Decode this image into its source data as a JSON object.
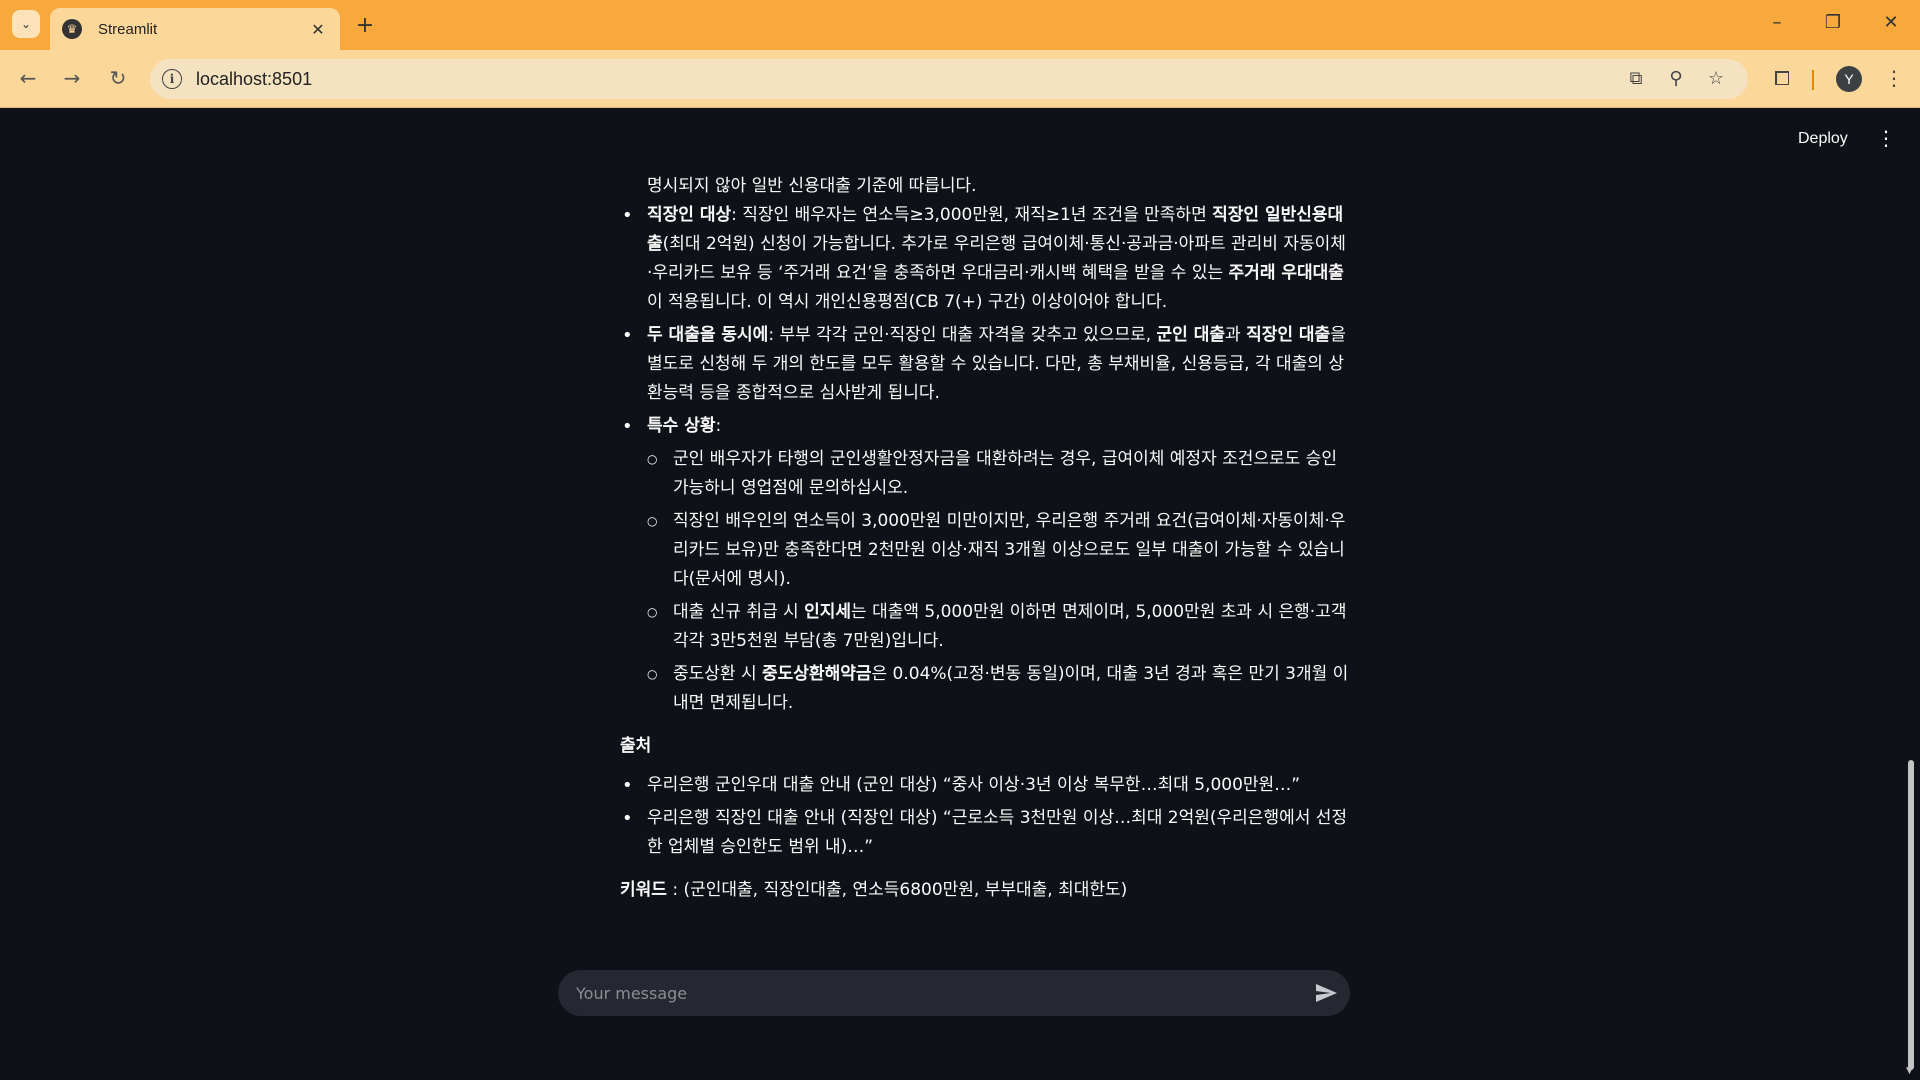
{
  "browser": {
    "tab_title": "Streamlit",
    "url": "localhost:8501",
    "profile_initial": "Y"
  },
  "app": {
    "deploy_label": "Deploy"
  },
  "message": {
    "intro_line": "명시되지 않아 일반 신용대출 기준에 따릅니다.",
    "bullet_worker": {
      "b1": "직장인 대상",
      "t1": ": 직장인 배우자는 연소득≥3,000만원, 재직≥1년 조건을 만족하면 ",
      "b2": "직장인 일반신용대출",
      "t2": "(최대 2억원) 신청이 가능합니다. 추가로 우리은행 급여이체·통신·공과금·아파트 관리비 자동이체·우리카드 보유 등 ‘주거래 요건’을 충족하면 우대금리·캐시백 혜택을 받을 수 있는 ",
      "b3": "주거래 우대대출",
      "t3": "이 적용됩니다. 이 역시 개인신용평점(CB 7(+) 구간) 이상이어야 합니다."
    },
    "bullet_both": {
      "b1": "두 대출을 동시에",
      "t1": ": 부부 각각 군인·직장인 대출 자격을 갖추고 있으므로, ",
      "b2": "군인 대출",
      "t2": "과 ",
      "b3": "직장인 대출",
      "t3": "을 별도로 신청해 두 개의 한도를 모두 활용할 수 있습니다. 다만, 총 부채비율, 신용등급, 각 대출의 상환능력 등을 종합적으로 심사받게 됩니다."
    },
    "bullet_special": {
      "b1": "특수 상황",
      "t1": ":"
    },
    "sub1": "군인 배우자가 타행의 군인생활안정자금을 대환하려는 경우, 급여이체 예정자 조건으로도 승인 가능하니 영업점에 문의하십시오.",
    "sub2": "직장인 배우인의 연소득이 3,000만원 미만이지만, 우리은행 주거래 요건(급여이체·자동이체·우리카드 보유)만 충족한다면 2천만원 이상·재직 3개월 이상으로도 일부 대출이 가능할 수 있습니다(문서에 명시).",
    "sub3": {
      "t1": "대출 신규 취급 시 ",
      "b1": "인지세",
      "t2": "는 대출액 5,000만원 이하면 면제이며, 5,000만원 초과 시 은행·고객 각각 3만5천원 부담(총 7만원)입니다."
    },
    "sub4": {
      "t1": "중도상환 시 ",
      "b1": "중도상환해약금",
      "t2": "은 0.04%(고정·변동 동일)이며, 대출 3년 경과 혹은 만기 3개월 이내면 면제됩니다."
    },
    "sources_heading": "출처",
    "source1": "우리은행 군인우대 대출 안내 (군인 대상) “중사 이상·3년 이상 복무한…최대 5,000만원…”",
    "source2": "우리은행 직장인 대출 안내 (직장인 대상) “근로소득 3천만원 이상…최대 2억원(우리은행에서 선정한 업체별 승인한도 범위 내)…”",
    "keywords_label": "키워드",
    "keywords_value": " : (군인대출, 직장인대출, 연소득6800만원, 부부대출, 최대한도)"
  },
  "chat": {
    "placeholder": "Your message"
  }
}
